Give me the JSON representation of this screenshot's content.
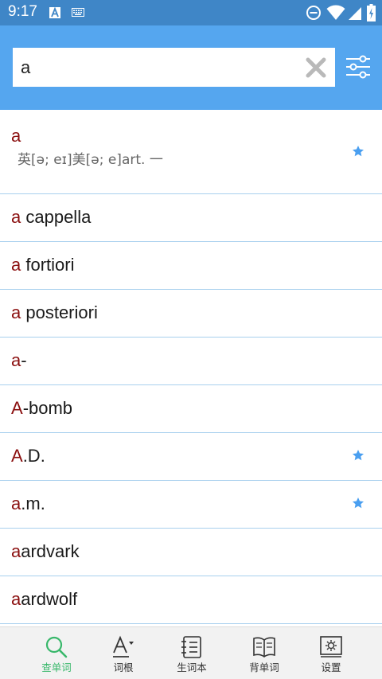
{
  "status_bar": {
    "time": "9:17"
  },
  "search": {
    "value": "a"
  },
  "entries": [
    {
      "highlight": "a",
      "rest": "",
      "phonetic": "英[ə; eɪ]美[ə; e]art. 一",
      "starred": true
    },
    {
      "highlight": "a",
      "rest": " cappella",
      "starred": false
    },
    {
      "highlight": "a",
      "rest": " fortiori",
      "starred": false
    },
    {
      "highlight": "a",
      "rest": " posteriori",
      "starred": false
    },
    {
      "highlight": "a",
      "rest": "-",
      "starred": false
    },
    {
      "highlight": "A",
      "rest": "-bomb",
      "starred": false
    },
    {
      "highlight": "A",
      "rest": ".D.",
      "starred": true
    },
    {
      "highlight": "a",
      "rest": ".m.",
      "starred": true
    },
    {
      "highlight": "a",
      "rest": "ardvark",
      "starred": false
    },
    {
      "highlight": "a",
      "rest": "ardwolf",
      "starred": false
    }
  ],
  "bottom_nav": [
    {
      "label": "查单词",
      "icon": "search-icon",
      "active": true
    },
    {
      "label": "词根",
      "icon": "word-root-icon",
      "active": false
    },
    {
      "label": "生词本",
      "icon": "notebook-icon",
      "active": false
    },
    {
      "label": "背单词",
      "icon": "open-book-icon",
      "active": false
    },
    {
      "label": "设置",
      "icon": "settings-icon",
      "active": false
    }
  ],
  "colors": {
    "status_bar": "#3f86c7",
    "header": "#55a6ef",
    "highlight_letter": "#8b1010",
    "star": "#4a9ff0",
    "active_nav": "#39b86b",
    "divider": "#a8d0ee"
  }
}
